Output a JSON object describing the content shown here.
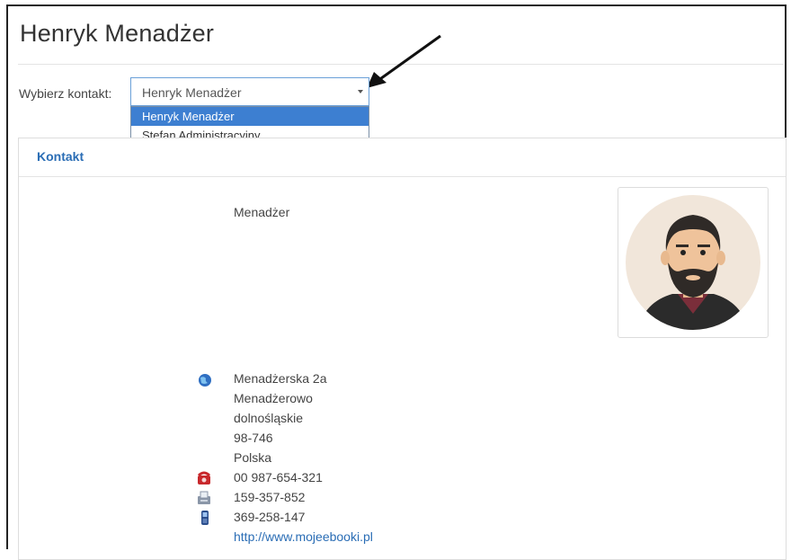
{
  "page": {
    "title": "Henryk Menadżer"
  },
  "contact_select": {
    "label": "Wybierz kontakt:",
    "value": "Henryk Menadżer",
    "options": [
      "Henryk Menadżer",
      "Stefan Administracyjny"
    ],
    "selected_index": 0
  },
  "panel": {
    "heading": "Kontakt",
    "position": "Menadżer",
    "address": {
      "street": "Menadżerska 2a",
      "city": "Menadżerowo",
      "region": "dolnośląskie",
      "postcode": "98-746",
      "country": "Polska"
    },
    "phone": "00 987-654-321",
    "fax": "159-357-852",
    "mobile": "369-258-147",
    "website": "http://www.mojeebooki.pl"
  },
  "icons": {
    "address": "globe-icon",
    "phone": "telephone-icon",
    "fax": "fax-icon",
    "mobile": "mobile-phone-icon",
    "avatar": "user-avatar"
  },
  "colors": {
    "link": "#2a6db5",
    "selected_option": "#3d7fd1"
  }
}
